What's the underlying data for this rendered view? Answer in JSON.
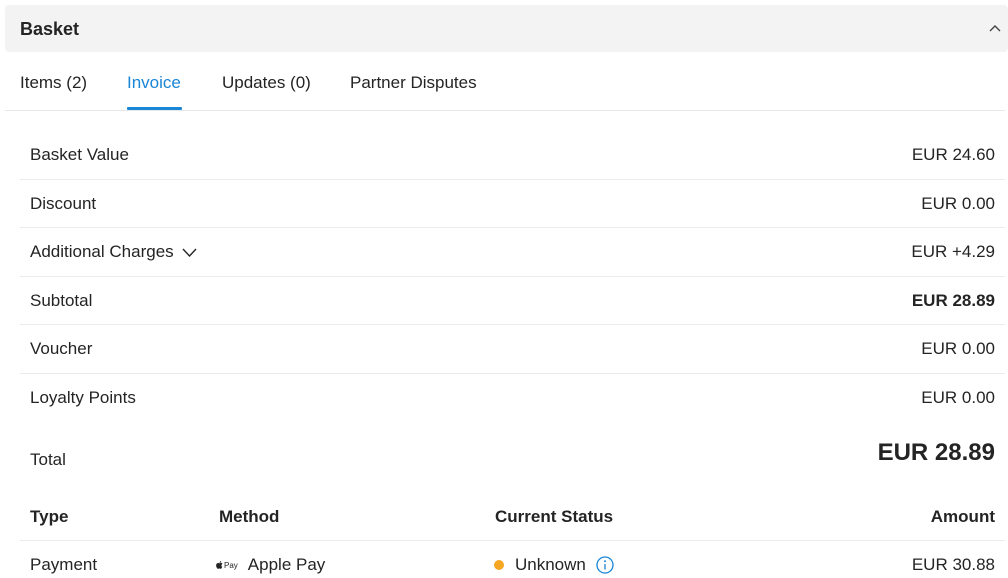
{
  "header": {
    "title": "Basket"
  },
  "tabs": [
    {
      "label": "Items (2)",
      "active": false
    },
    {
      "label": "Invoice",
      "active": true
    },
    {
      "label": "Updates (0)",
      "active": false
    },
    {
      "label": "Partner Disputes",
      "active": false
    }
  ],
  "summary": [
    {
      "label": "Basket Value",
      "value": "EUR 24.60"
    },
    {
      "label": "Discount",
      "value": "EUR 0.00"
    },
    {
      "label": "Additional Charges",
      "value": "EUR +4.29"
    },
    {
      "label": "Subtotal",
      "value": "EUR 28.89"
    },
    {
      "label": "Voucher",
      "value": "EUR 0.00"
    },
    {
      "label": "Loyalty Points",
      "value": "EUR 0.00"
    }
  ],
  "total": {
    "label": "Total",
    "value": "EUR 28.89"
  },
  "payments": {
    "columns": {
      "type": "Type",
      "method": "Method",
      "status": "Current Status",
      "amount": "Amount"
    },
    "rows": [
      {
        "type": "Payment",
        "method_logo": "Pay",
        "method": "Apple Pay",
        "status": "Unknown",
        "amount": "EUR 30.88"
      }
    ]
  },
  "colors": {
    "accent": "#1a86d6",
    "status_unknown": "#f5a623",
    "header_bg": "#f3f3f3"
  },
  "icons": {
    "collapse": "chevron-up-icon",
    "expand_charges": "chevron-down-icon",
    "info": "info-icon",
    "apple": "apple-logo-icon"
  }
}
